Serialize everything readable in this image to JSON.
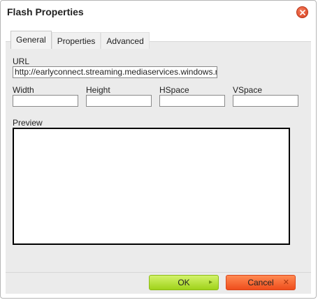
{
  "dialog": {
    "title": "Flash Properties"
  },
  "tabs": [
    {
      "label": "General"
    },
    {
      "label": "Properties"
    },
    {
      "label": "Advanced"
    }
  ],
  "general": {
    "url_label": "URL",
    "url_value": "http://earlyconnect.streaming.mediaservices.windows.n",
    "width_label": "Width",
    "height_label": "Height",
    "hspace_label": "HSpace",
    "vspace_label": "VSpace",
    "width_value": "",
    "height_value": "",
    "hspace_value": "",
    "vspace_value": "",
    "preview_label": "Preview"
  },
  "buttons": {
    "ok_label": "OK",
    "cancel_label": "Cancel",
    "ok_icon": "triangle-right-icon",
    "cancel_icon": "x-icon"
  },
  "colors": {
    "ok_green": "#a8d82a",
    "cancel_orange": "#f25a24",
    "close_red": "#e04a25"
  }
}
